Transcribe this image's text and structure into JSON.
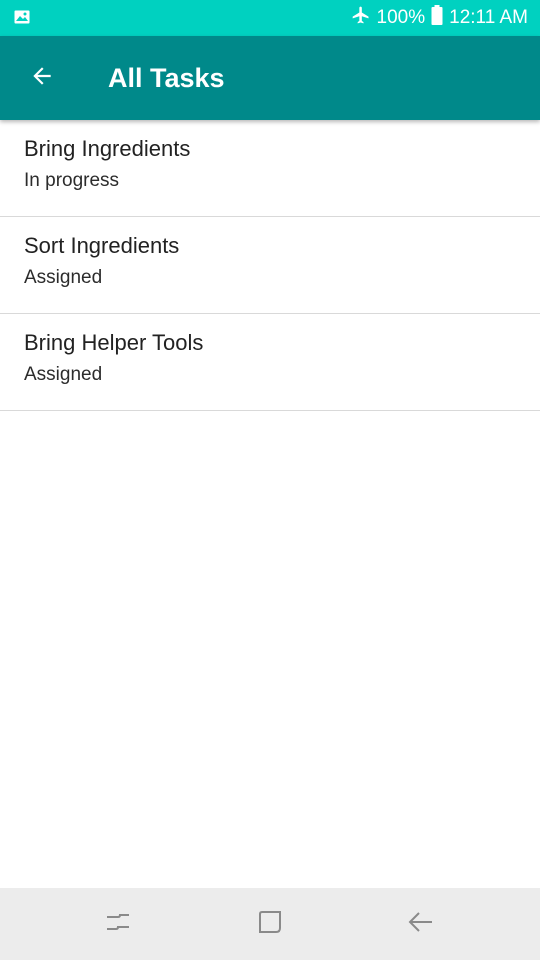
{
  "status_bar": {
    "left_icon": "image-icon",
    "airplane_icon": "airplane-icon",
    "battery_text": "100%",
    "battery_icon": "battery-icon",
    "time": "12:11 AM"
  },
  "app_bar": {
    "back_icon": "back-arrow-icon",
    "title": "All Tasks",
    "color": "#00898a"
  },
  "tasks": [
    {
      "title": "Bring Ingredients",
      "status": "In progress"
    },
    {
      "title": "Sort Ingredients",
      "status": "Assigned"
    },
    {
      "title": "Bring Helper Tools",
      "status": "Assigned"
    }
  ],
  "nav_bar": {
    "recents_icon": "recents-icon",
    "home_icon": "home-icon",
    "back_icon": "back-icon"
  },
  "colors": {
    "status_bar": "#00d1c0",
    "app_bar": "#00898a"
  }
}
